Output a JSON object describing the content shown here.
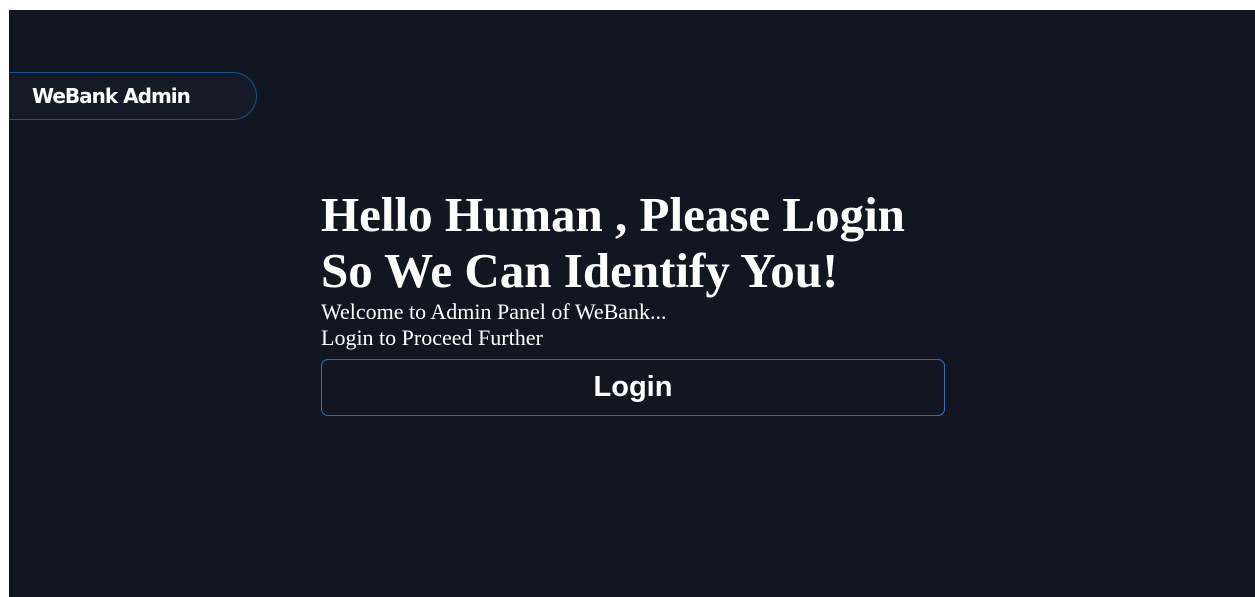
{
  "header": {
    "brand": "WeBank Admin"
  },
  "main": {
    "headline_line1": "Hello Human , Please Login",
    "headline_line2": "So We Can Identify You!",
    "welcome_text": "Welcome to Admin Panel of WeBank...",
    "instruction_text": "Login to Proceed Further",
    "login_label": "Login"
  },
  "colors": {
    "background": "#111621",
    "accent_border": "#2f6fc0",
    "text": "#ffffff"
  }
}
